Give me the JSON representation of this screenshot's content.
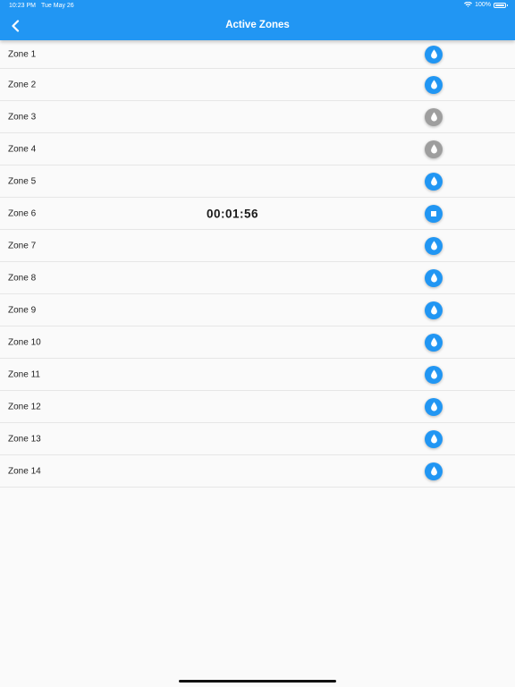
{
  "status_bar": {
    "time": "10:23 PM",
    "date": "Tue May 26",
    "battery": "100%"
  },
  "header": {
    "title": "Active Zones"
  },
  "zones": [
    {
      "label": "Zone 1",
      "icon": "water-drop-icon",
      "state": "active",
      "timer": ""
    },
    {
      "label": "Zone 2",
      "icon": "water-drop-icon",
      "state": "active",
      "timer": ""
    },
    {
      "label": "Zone 3",
      "icon": "water-drop-icon",
      "state": "inactive",
      "timer": ""
    },
    {
      "label": "Zone 4",
      "icon": "water-drop-icon",
      "state": "inactive",
      "timer": ""
    },
    {
      "label": "Zone 5",
      "icon": "water-drop-icon",
      "state": "active",
      "timer": ""
    },
    {
      "label": "Zone 6",
      "icon": "stop-icon",
      "state": "active",
      "timer": "00:01:56"
    },
    {
      "label": "Zone 7",
      "icon": "water-drop-icon",
      "state": "active",
      "timer": ""
    },
    {
      "label": "Zone 8",
      "icon": "water-drop-icon",
      "state": "active",
      "timer": ""
    },
    {
      "label": "Zone 9",
      "icon": "water-drop-icon",
      "state": "active",
      "timer": ""
    },
    {
      "label": "Zone 10",
      "icon": "water-drop-icon",
      "state": "active",
      "timer": ""
    },
    {
      "label": "Zone 11",
      "icon": "water-drop-icon",
      "state": "active",
      "timer": ""
    },
    {
      "label": "Zone 12",
      "icon": "water-drop-icon",
      "state": "active",
      "timer": ""
    },
    {
      "label": "Zone 13",
      "icon": "water-drop-icon",
      "state": "active",
      "timer": ""
    },
    {
      "label": "Zone 14",
      "icon": "water-drop-icon",
      "state": "active",
      "timer": ""
    }
  ],
  "colors": {
    "primary": "#2196f3",
    "inactive": "#9e9e9e",
    "background": "#fafafa"
  }
}
